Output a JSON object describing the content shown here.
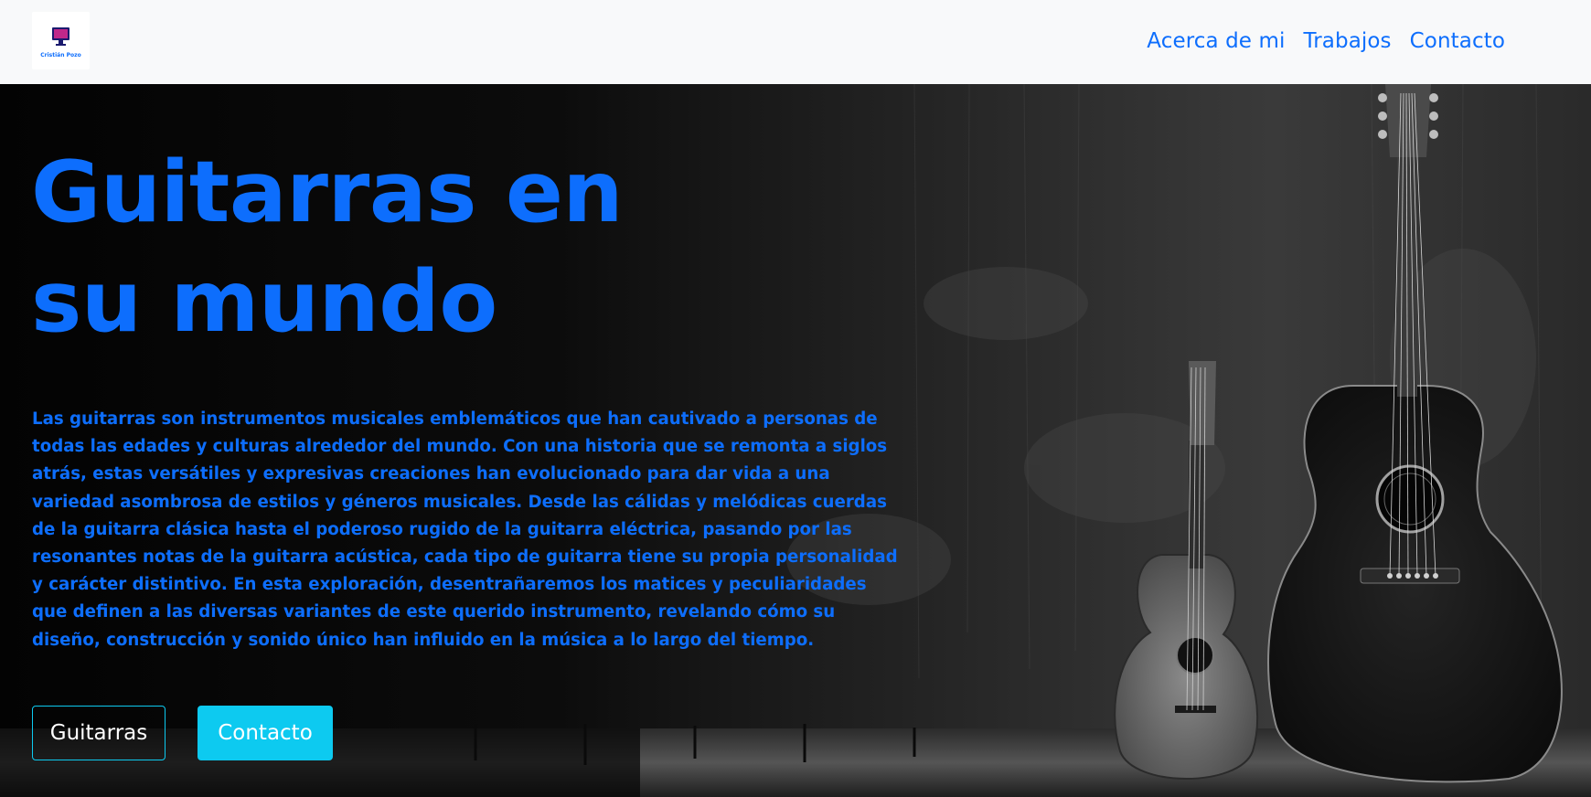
{
  "brand": {
    "logo_text": "Cristián Pozo",
    "icon": "monitor-logo-icon"
  },
  "nav": {
    "items": [
      {
        "label": "Acerca de mi"
      },
      {
        "label": "Trabajos"
      },
      {
        "label": "Contacto"
      }
    ]
  },
  "hero": {
    "title_line1": "Guitarras en",
    "title_line2": "su mundo",
    "description": "Las guitarras son instrumentos musicales emblemáticos que han cautivado a personas de todas las edades y culturas alrededor del mundo. Con una historia que se remonta a siglos atrás, estas versátiles y expresivas creaciones han evolucionado para dar vida a una variedad asombrosa de estilos y géneros musicales. Desde las cálidas y melódicas cuerdas de la guitarra clásica hasta el poderoso rugido de la guitarra eléctrica, pasando por las resonantes notas de la guitarra acústica, cada tipo de guitarra tiene su propia personalidad y carácter distintivo. En esta exploración, desentrañaremos los matices y peculiaridades que definen a las diversas variantes de este querido instrumento, revelando cómo su diseño, construcción y sonido único han influido en la música a lo largo del tiempo.",
    "buttons": {
      "primary_label": "Guitarras",
      "secondary_label": "Contacto"
    }
  },
  "colors": {
    "accent": "#0d6efd",
    "button_info": "#0dcaf0",
    "navbar_bg": "#f8f9fa"
  }
}
